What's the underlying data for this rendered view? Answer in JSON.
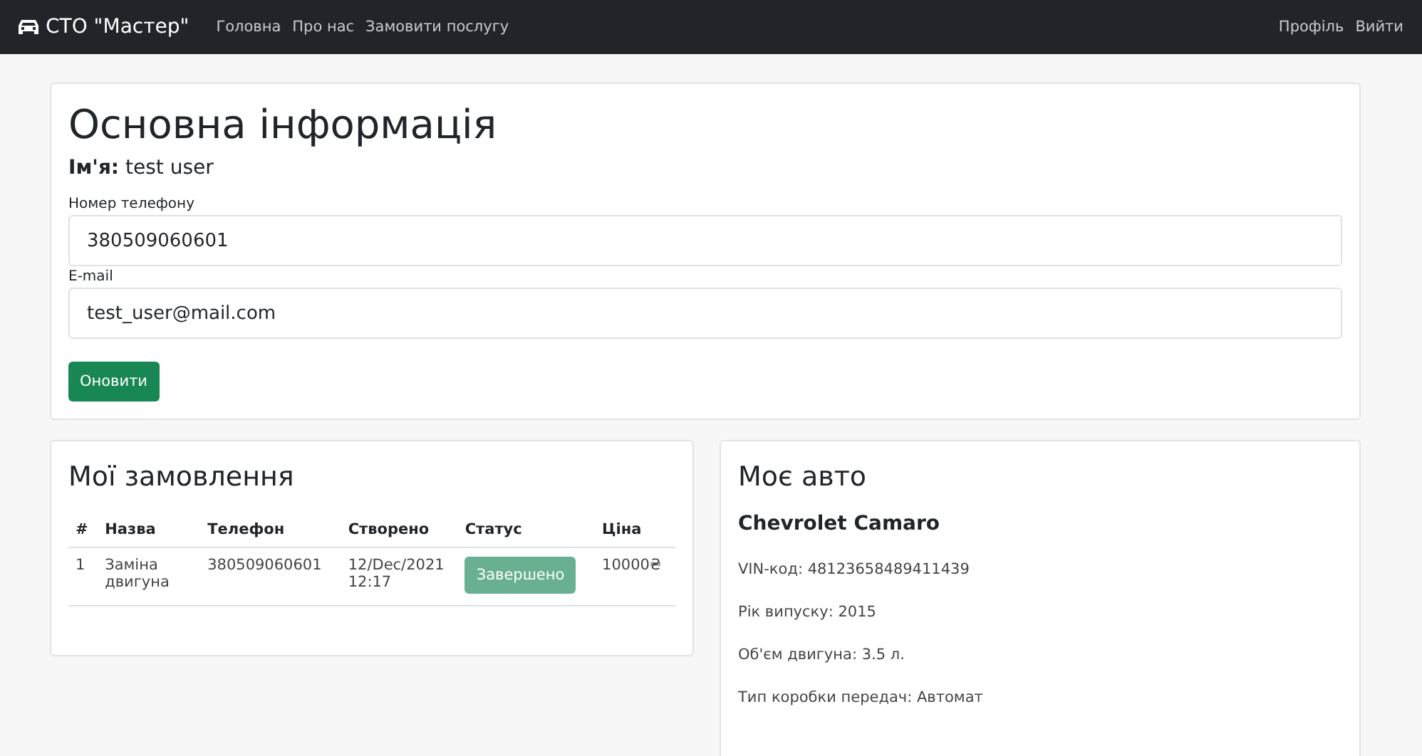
{
  "navbar": {
    "brand": "СТО \"Мастер\"",
    "links": [
      "Головна",
      "Про нас",
      "Замовити послугу"
    ],
    "right_links": [
      "Профіль",
      "Вийти"
    ]
  },
  "profile": {
    "title": "Основна інформація",
    "name_label": "Ім'я:",
    "name_value": "test user",
    "fields": [
      {
        "label": "Номер телефону",
        "value": "380509060601"
      },
      {
        "label": "E-mail",
        "value": "test_user@mail.com"
      }
    ],
    "button": "Оновити"
  },
  "orders": {
    "title": "Мої замовлення",
    "columns": [
      "#",
      "Назва",
      "Телефон",
      "Створено",
      "Статус",
      "Ціна"
    ],
    "rows": [
      {
        "number": "1",
        "name": "Заміна двигуна",
        "phone": "380509060601",
        "created": "12/Dec/2021 12:17",
        "status": "Завершено",
        "price": "10000₴"
      }
    ]
  },
  "car": {
    "title": "Моє авто",
    "model": "Chevrolet Camaro",
    "details": [
      "VIN-код: 48123658489411439",
      "Рік випуску: 2015",
      "Об'єм двигуна: 3.5 л.",
      "Тип коробки передач: Автомат"
    ]
  }
}
